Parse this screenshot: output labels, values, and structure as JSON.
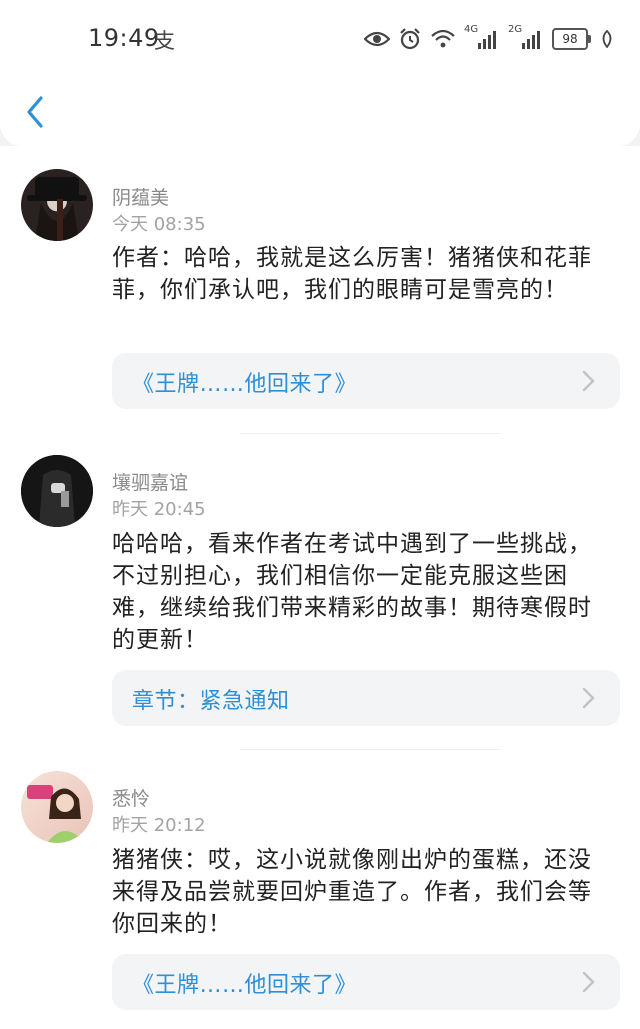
{
  "status_bar": {
    "time": "19:49",
    "alipay_glyph": "支",
    "network_4g": "4G",
    "network_2g": "2G",
    "battery": "98"
  },
  "header": {
    "back_icon": "chevron-left-icon"
  },
  "colors": {
    "link": "#2f8fd5",
    "accent_back": "#2f8fd5",
    "username": "#8a8a8a"
  },
  "comments": [
    {
      "username": "阴蕴美",
      "time": "今天 08:35",
      "content": "作者：哈哈，我就是这么厉害！猪猪侠和花菲菲，你们承认吧，我们的眼睛可是雪亮的！",
      "link": "《王牌……他回来了》"
    },
    {
      "username": "壤驷嘉谊",
      "time": "昨天 20:45",
      "content": "哈哈哈，看来作者在考试中遇到了一些挑战，不过别担心，我们相信你一定能克服这些困难，继续给我们带来精彩的故事！期待寒假时的更新！",
      "link": "章节：紧急通知"
    },
    {
      "username": "悉怜",
      "time": "昨天 20:12",
      "content": "猪猪侠：哎，这小说就像刚出炉的蛋糕，还没来得及品尝就要回炉重造了。作者，我们会等你回来的！",
      "link": "《王牌……他回来了》"
    }
  ]
}
